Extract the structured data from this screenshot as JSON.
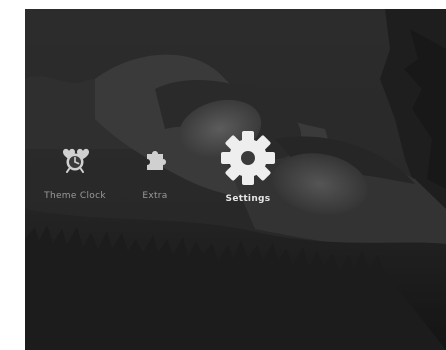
{
  "menu": {
    "items": [
      {
        "id": "theme_clock",
        "label": "Theme Clock",
        "icon": "alarm-clock-icon",
        "selected": false
      },
      {
        "id": "extra",
        "label": "Extra",
        "icon": "puzzle-piece-icon",
        "selected": false
      },
      {
        "id": "settings",
        "label": "Settings",
        "icon": "gear-icon",
        "selected": true
      }
    ]
  },
  "colors": {
    "label_normal": "#9a9a9a",
    "label_selected": "#e6e6e6",
    "icon_normal": "#d0d0d0",
    "icon_selected": "#eeeeee"
  }
}
